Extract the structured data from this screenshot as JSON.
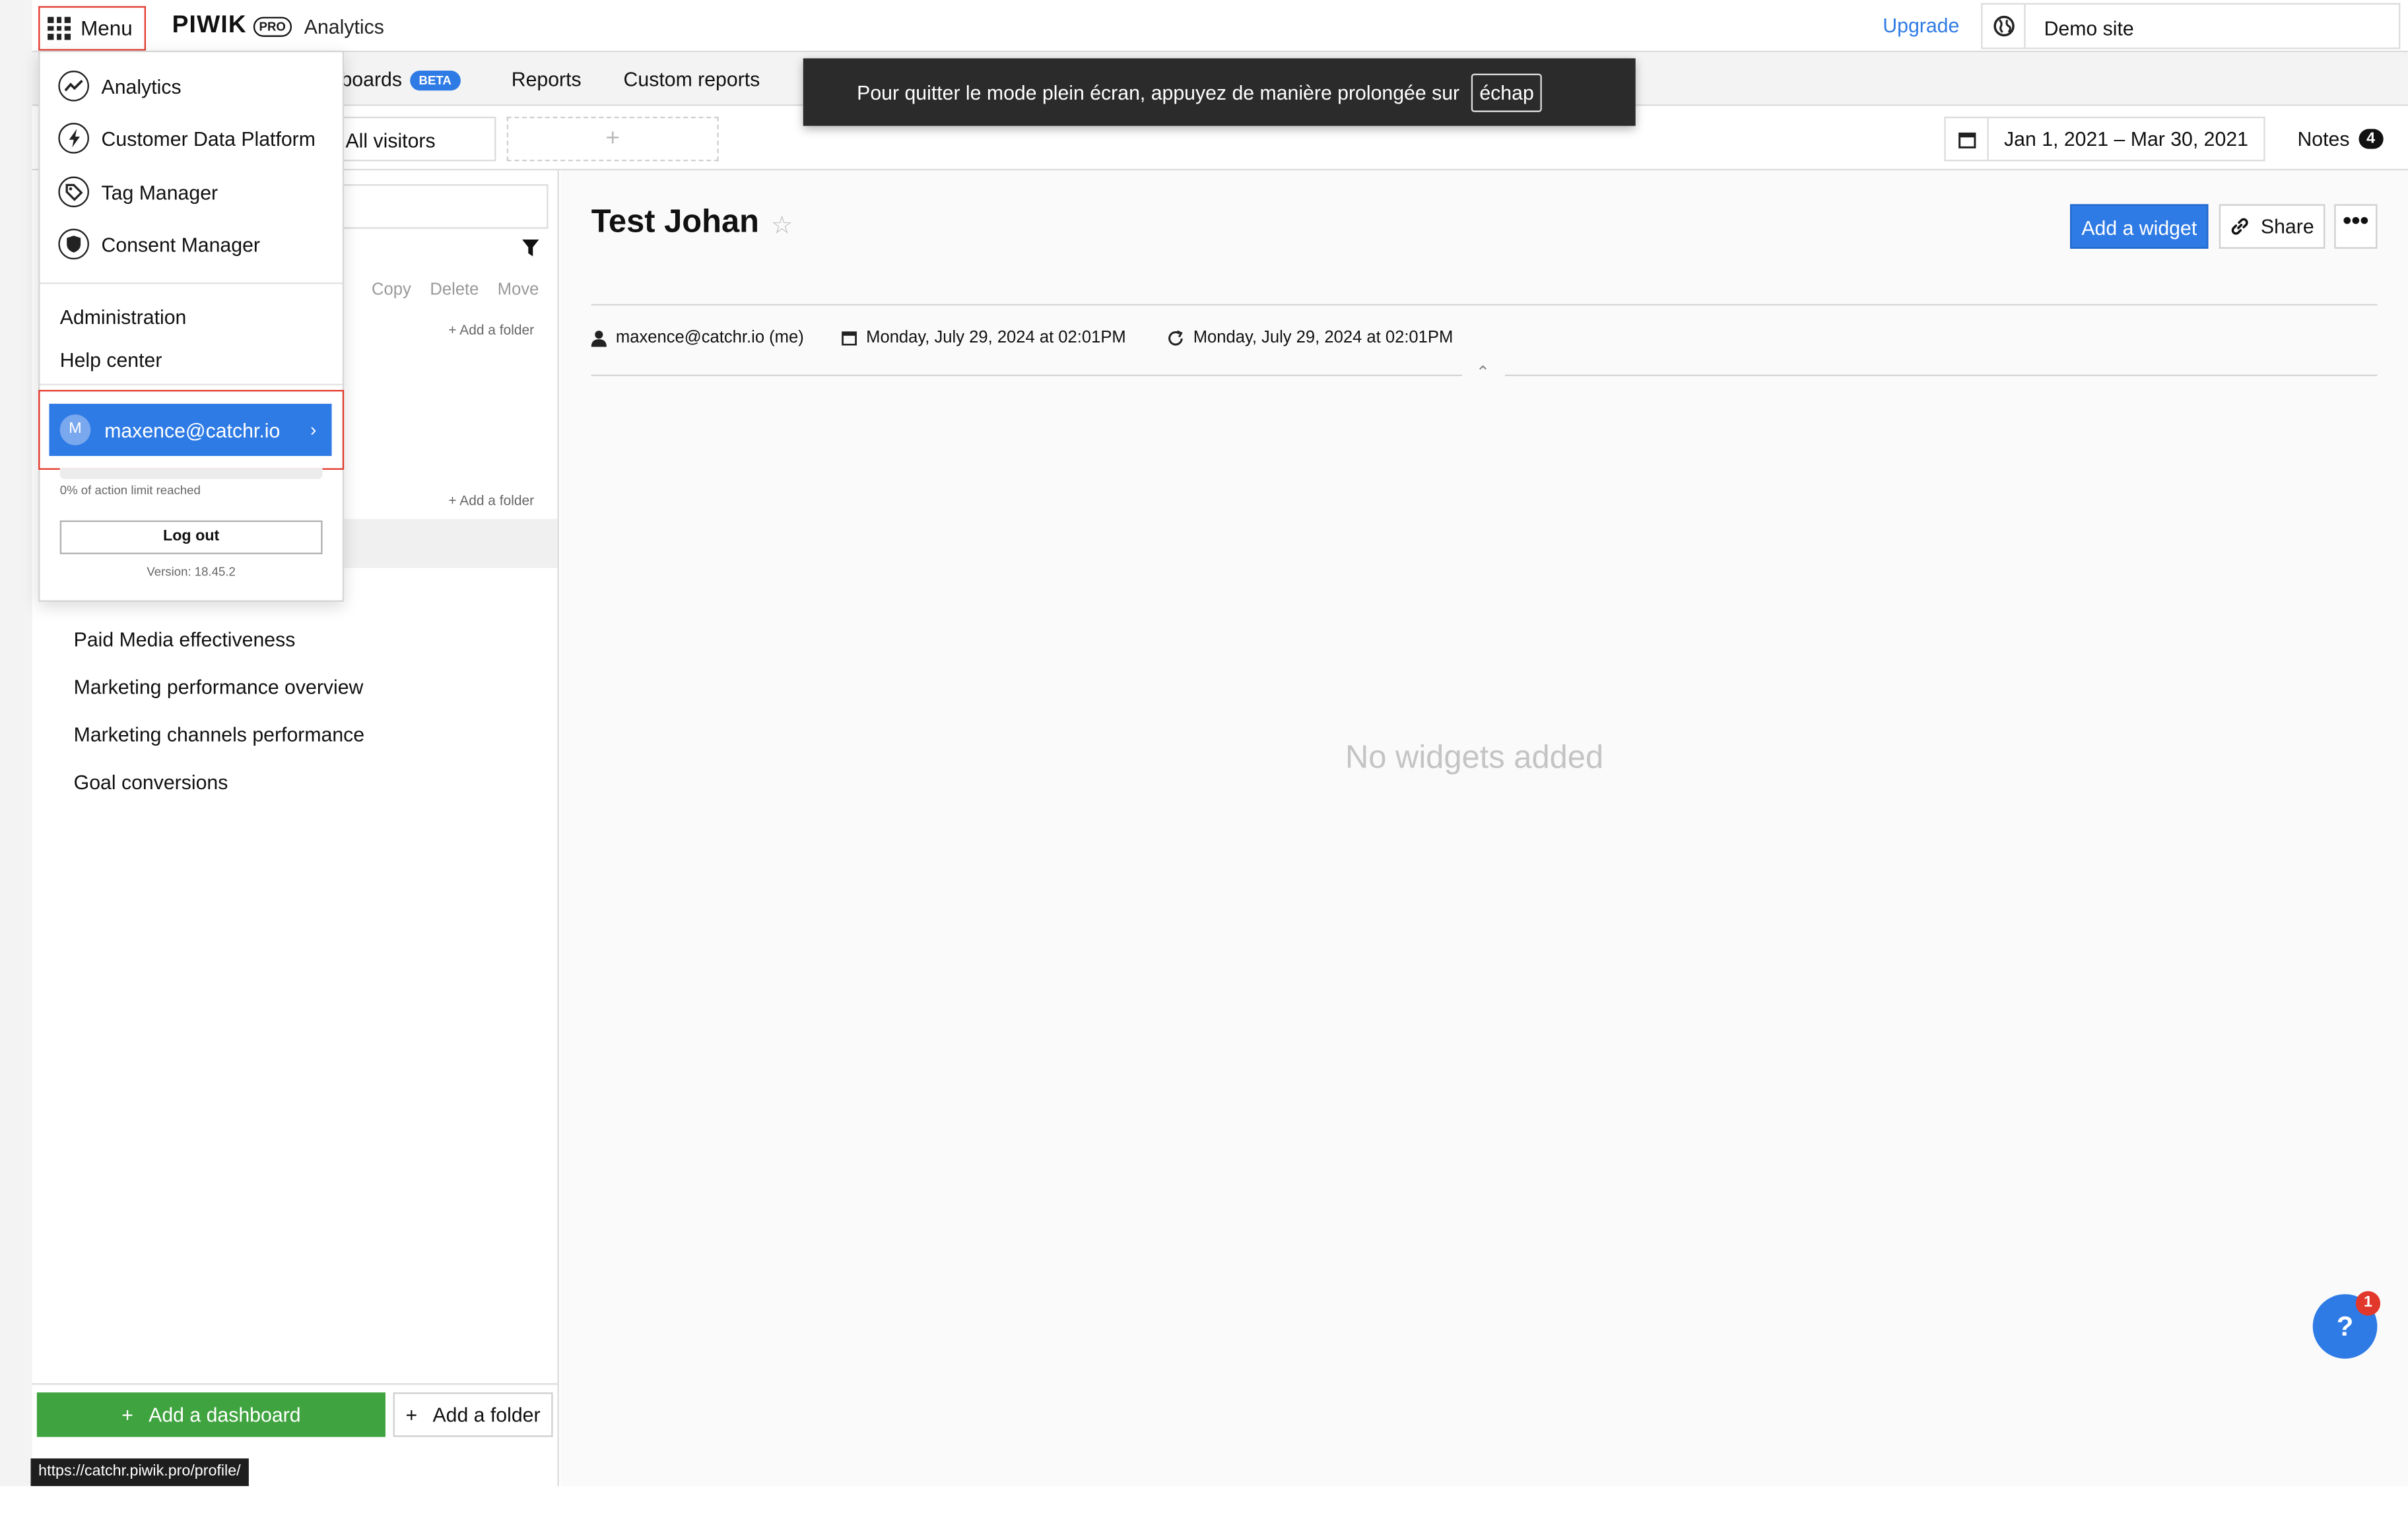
{
  "topbar": {
    "menu_label": "Menu",
    "brand": "PIWIK",
    "brand_badge": "PRO",
    "app_name": "Analytics",
    "upgrade_label": "Upgrade",
    "site_name": "Demo site"
  },
  "nav": {
    "dashboards_partial": "boards",
    "beta_badge": "BETA",
    "reports": "Reports",
    "custom_reports": "Custom reports"
  },
  "toast": {
    "message": "Pour quitter le mode plein écran, appuyez de manière prolongée sur",
    "key": "échap"
  },
  "toolbar": {
    "segment": "All visitors",
    "add_segment": "+",
    "date_range": "Jan 1, 2021 – Mar 30, 2021",
    "notes_label": "Notes",
    "notes_count": "4"
  },
  "sidebar": {
    "actions": {
      "copy": "Copy",
      "delete": "Delete",
      "move": "Move"
    },
    "add_folder_small": "+ Add a folder",
    "dashboards": [
      "Paid Media effectiveness",
      "Marketing performance overview",
      "Marketing channels performance",
      "Goal conversions"
    ],
    "add_dashboard": "Add a dashboard",
    "add_folder": "Add a folder"
  },
  "main": {
    "title": "Test Johan",
    "add_widget": "Add a widget",
    "share": "Share",
    "more": "•••",
    "owner": "maxence@catchr.io (me)",
    "created": "Monday, July 29, 2024 at 02:01PM",
    "updated": "Monday, July 29, 2024 at 02:01PM",
    "empty_state": "No widgets added",
    "help_label": "?",
    "help_badge": "1"
  },
  "menu": {
    "products": [
      "Analytics",
      "Customer Data Platform",
      "Tag Manager",
      "Consent Manager"
    ],
    "administration": "Administration",
    "help_center": "Help center",
    "user_initial": "M",
    "user_email": "maxence@catchr.io",
    "limit_text": "0% of action limit reached",
    "limit_fraction": 0,
    "logout": "Log out",
    "version": "Version: 18.45.2"
  },
  "status_url": "https://catchr.piwik.pro/profile/",
  "colors": {
    "accent": "#2f7be5",
    "success": "#3fa33f",
    "highlight_border": "#e2372b"
  }
}
